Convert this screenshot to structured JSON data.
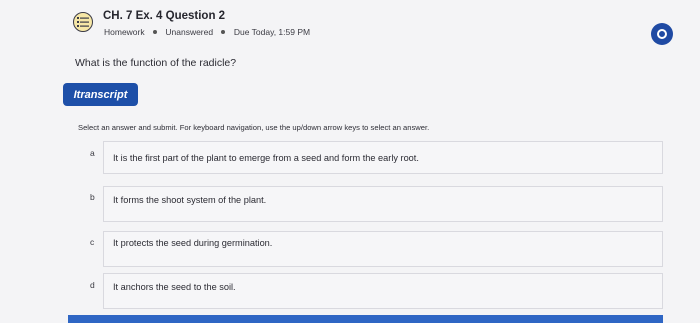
{
  "header": {
    "title": "CH. 7 Ex. 4 Question 2",
    "category": "Homework",
    "status": "Unanswered",
    "due": "Due Today, 1:59 PM"
  },
  "question": {
    "prompt": "What is the function of the radicle?"
  },
  "transcript_button": {
    "label": "Itranscript"
  },
  "instructions": "Select an answer and submit. For keyboard navigation, use the up/down arrow keys to select an answer.",
  "options": [
    {
      "letter": "a",
      "text": "It is the first part of the plant to emerge from a seed and form the early root."
    },
    {
      "letter": "b",
      "text": "It forms the shoot system of the plant."
    },
    {
      "letter": "c",
      "text": "It protects the seed during germination."
    },
    {
      "letter": "d",
      "text": "It anchors the seed to the soil."
    }
  ],
  "colors": {
    "accent": "#1d4fa8",
    "status_circle": "#1f4aa3",
    "icon_bg": "#f6e7a6"
  },
  "icons": {
    "question_type": "list-icon",
    "status": "status-circle-icon"
  }
}
